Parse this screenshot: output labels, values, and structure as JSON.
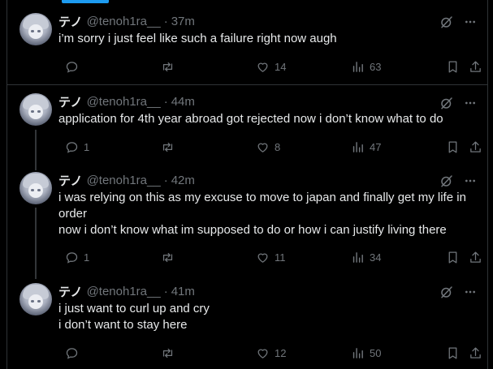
{
  "tweets": [
    {
      "name": "テノ",
      "handle": "@tenoh1ra__",
      "time": "37m",
      "lines": [
        "i’m sorry i just feel like such a failure right now augh"
      ],
      "replies": "",
      "retweets": "",
      "likes": "14",
      "views": "63"
    },
    {
      "name": "テノ",
      "handle": "@tenoh1ra__",
      "time": "44m",
      "lines": [
        "application for 4th year abroad got rejected now i don’t know what to do"
      ],
      "replies": "1",
      "retweets": "",
      "likes": "8",
      "views": "47"
    },
    {
      "name": "テノ",
      "handle": "@tenoh1ra__",
      "time": "42m",
      "lines": [
        "i was relying on this as my excuse to move to japan and finally get my life in",
        "order",
        "now i don’t know what im supposed to do or how i can justify living there"
      ],
      "replies": "1",
      "retweets": "",
      "likes": "11",
      "views": "34"
    },
    {
      "name": "テノ",
      "handle": "@tenoh1ra__",
      "time": "41m",
      "lines": [
        "i just want to curl up and cry",
        "i don’t want to stay here"
      ],
      "replies": "",
      "retweets": "",
      "likes": "12",
      "views": "50"
    }
  ],
  "dot": "·",
  "icons": {
    "reply": "reply-icon",
    "retweet": "retweet-icon",
    "like": "heart-icon",
    "views": "views-icon",
    "bookmark": "bookmark-icon",
    "share": "share-icon",
    "grok": "grok-icon",
    "more": "more-icon"
  },
  "colors": {
    "background": "#000000",
    "text": "#e7e9ea",
    "muted": "#71767b",
    "accent": "#1d9bf0",
    "border": "#2f3336"
  }
}
